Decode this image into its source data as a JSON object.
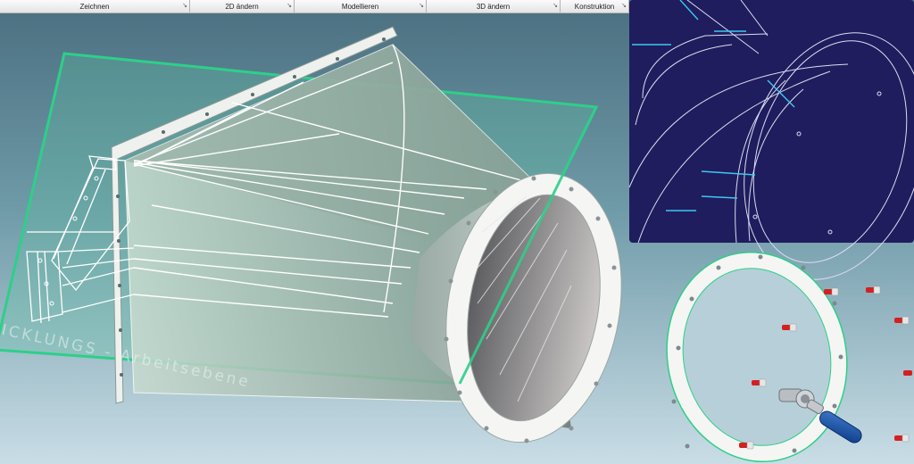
{
  "toolbar": {
    "groups": [
      {
        "label": "Zeichnen"
      },
      {
        "label": "2D ändern"
      },
      {
        "label": "Modellieren"
      },
      {
        "label": "3D ändern"
      },
      {
        "label": "Konstruktion"
      }
    ]
  },
  "viewport": {
    "watermark": "ICKLUNGS - Arbeitsebene"
  },
  "colors": {
    "background_top": "#4e7484",
    "background_bottom": "#c6dce6",
    "detail_panel": "#1f1d5e",
    "work_plane": "#2ecf8a",
    "wireframe": "#ffffff",
    "flange": "#f2f4f2",
    "bolt_cap": "#d42020"
  },
  "icons": {
    "toolbar_group_arrow": "expand-arrow-icon",
    "ratchet": "ratchet-wrench-icon",
    "bolt": "bolt-icon"
  }
}
